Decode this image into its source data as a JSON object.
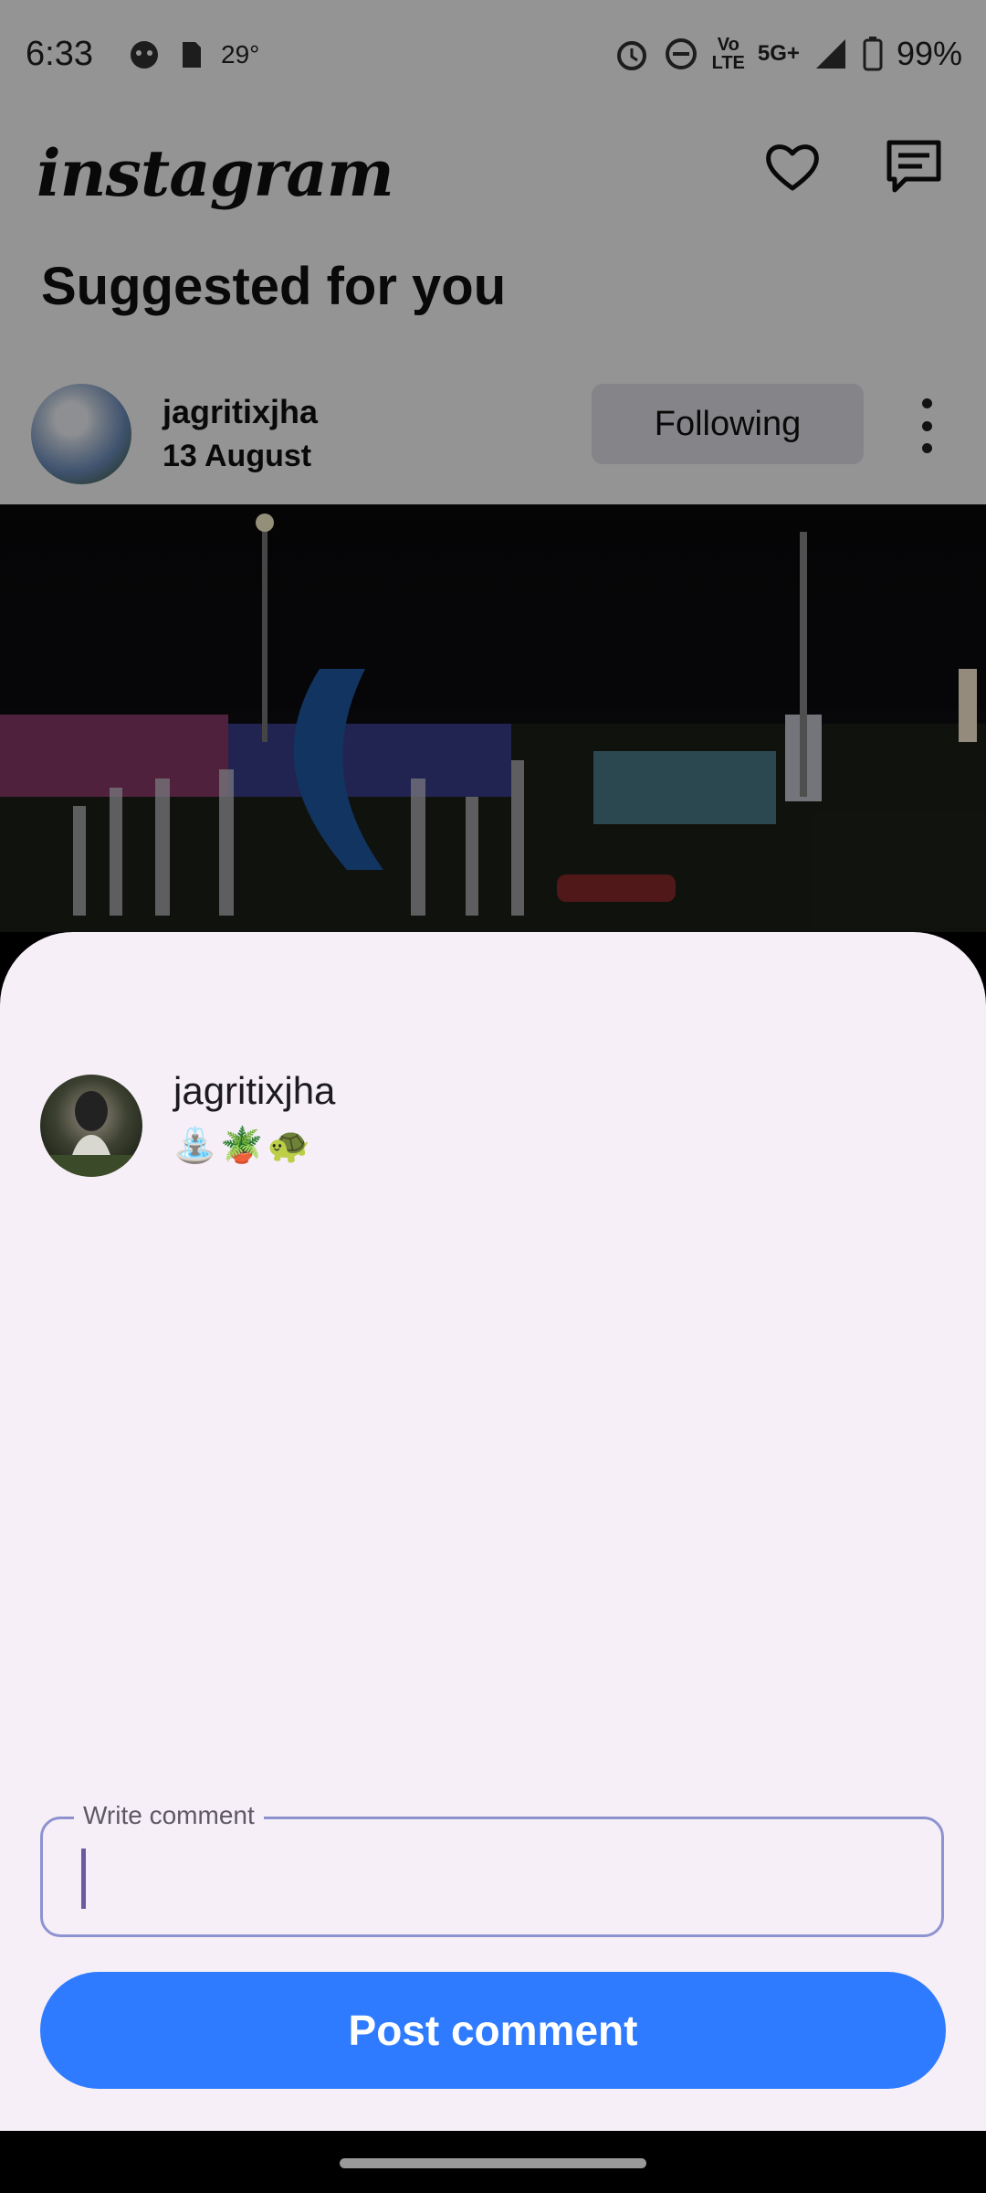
{
  "status_bar": {
    "time": "6:33",
    "temperature": "29°",
    "network_top": "Vo",
    "network_bottom": "LTE",
    "network_type": "5G+",
    "battery": "99%"
  },
  "header": {
    "logo": "instagram",
    "icons": [
      "heart-icon",
      "message-icon"
    ]
  },
  "feed": {
    "section_title": "Suggested for you",
    "post": {
      "username": "jagritixjha",
      "date": "13 August",
      "follow_label": "Following"
    }
  },
  "sheet": {
    "username": "jagritixjha",
    "bio_emoji": "⛲🪴🐢",
    "comment_label": "Write comment",
    "comment_value": "",
    "post_button": "Post comment"
  },
  "colors": {
    "accent_button": "#2f7bff",
    "sheet_bg": "#f6eff7",
    "field_outline": "#8e93d0"
  }
}
